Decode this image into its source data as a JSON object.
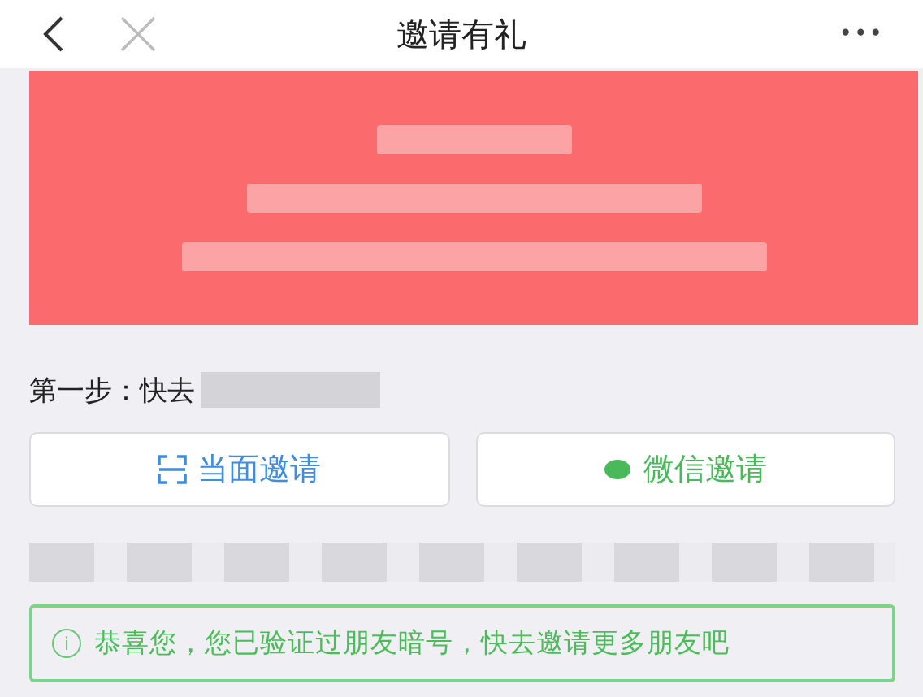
{
  "nav": {
    "title": "邀请有礼",
    "more": "•••"
  },
  "step": {
    "label": "第一步：快去"
  },
  "buttons": [
    {
      "kind": "scan",
      "label": "当面邀请"
    },
    {
      "kind": "wechat",
      "label": "微信邀请"
    }
  ],
  "notice": {
    "icon": "i",
    "text": "恭喜您，您已验证过朋友暗号，快去邀请更多朋友吧"
  }
}
